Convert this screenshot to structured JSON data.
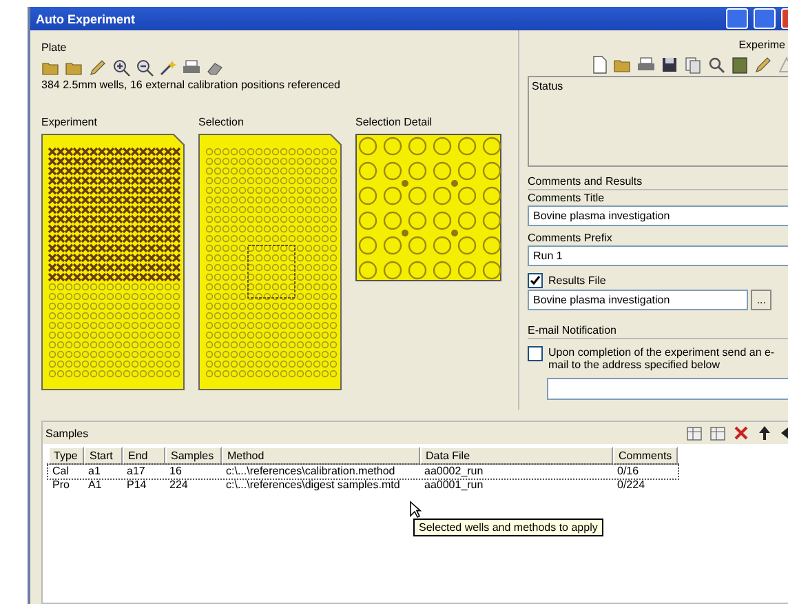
{
  "window": {
    "title": "Auto Experiment"
  },
  "plate": {
    "label": "Plate",
    "description": "384 2.5mm wells, 16 external calibration positions referenced",
    "views": [
      "Experiment",
      "Selection",
      "Selection Detail"
    ]
  },
  "experiment_panel": {
    "label": "Experime",
    "status_label": "Status"
  },
  "comments_and_results": {
    "label": "Comments and Results",
    "title_label": "Comments Title",
    "title_value": "Bovine plasma investigation",
    "prefix_label": "Comments Prefix",
    "prefix_value": "Run 1",
    "results_file": {
      "label": "Results File",
      "checked": true
    },
    "results_file_value": "Bovine plasma investigation",
    "browse_button": "..."
  },
  "email_notification": {
    "label": "E-mail Notification",
    "option": {
      "label": "Upon completion of the experiment send an e-mail to the address specified below",
      "checked": false
    }
  },
  "samples": {
    "label": "Samples",
    "columns": [
      "Type",
      "Start",
      "End",
      "Samples",
      "Method",
      "Data File",
      "Comments"
    ],
    "rows": [
      {
        "cells": [
          "Cal",
          "a1",
          "a17",
          "16",
          "c:\\...\\references\\calibration.method",
          "aa0002_run",
          "0/16"
        ],
        "selected": true
      },
      {
        "cells": [
          "Pro",
          "A1",
          "P14",
          "224",
          "c:\\...\\references\\digest samples.mtd",
          "aa0001_run",
          "0/224"
        ],
        "selected": false
      }
    ]
  },
  "tooltip": "Selected wells and methods to apply"
}
